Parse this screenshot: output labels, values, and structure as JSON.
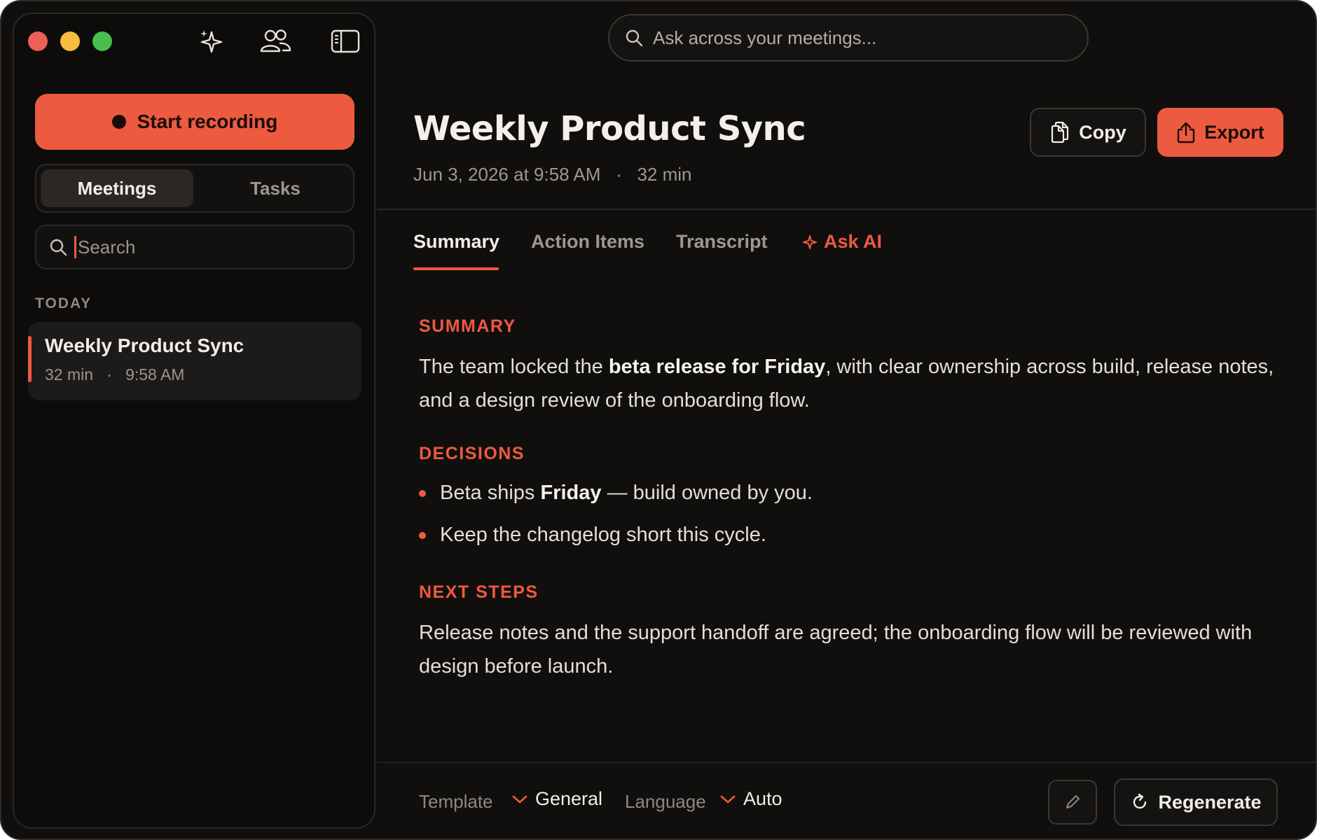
{
  "sidebar": {
    "start_recording": "Start recording",
    "tabs": {
      "meetings": "Meetings",
      "tasks": "Tasks"
    },
    "search_placeholder": "Search",
    "section": "TODAY",
    "meetings": [
      {
        "title": "Weekly Product Sync",
        "duration": "32 min",
        "time": "9:58 AM"
      }
    ]
  },
  "header": {
    "ask_placeholder": "Ask across your meetings...",
    "title": "Weekly Product Sync",
    "date": "Jun 3, 2026 at 9:58 AM",
    "duration": "32 min",
    "copy_label": "Copy",
    "export_label": "Export"
  },
  "tabs": {
    "summary": "Summary",
    "action_items": "Action Items",
    "transcript": "Transcript",
    "ask_ai": "Ask AI"
  },
  "content": {
    "summary_heading": "SUMMARY",
    "summary_pre": "The team locked the ",
    "summary_bold": "beta release for Friday",
    "summary_post": ", with clear ownership across build, release notes, and a design review of the onboarding flow.",
    "decisions_heading": "DECISIONS",
    "decision1_pre": "Beta ships ",
    "decision1_bold": "Friday",
    "decision1_post": " — build owned by you.",
    "decision2": "Keep the changelog short this cycle.",
    "next_heading": "NEXT STEPS",
    "next_text": "Release notes and the support handoff are agreed; the onboarding flow will be reviewed with design before launch."
  },
  "footer": {
    "template_label": "Template",
    "template_value": "General",
    "language_label": "Language",
    "language_value": "Auto",
    "regenerate_label": "Regenerate"
  },
  "colors": {
    "accent": "#ec5a40",
    "background": "#110f0d"
  }
}
